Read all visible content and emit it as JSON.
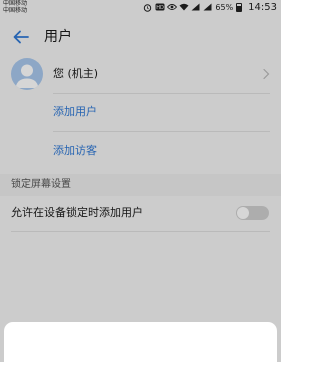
{
  "status_bar": {
    "carrier_line1": "中国移动",
    "carrier_line2": "中国移动",
    "network": "4G",
    "battery": "65%",
    "time": "14:53",
    "icons": [
      "alarm-icon",
      "hd-icon",
      "eye-icon",
      "wifi-icon",
      "signal-icon",
      "signal-icon",
      "battery-icon"
    ]
  },
  "header": {
    "title": "用户",
    "back_icon": "back-arrow-icon"
  },
  "users": {
    "owner_label": "您 (机主)",
    "add_user": "添加用户",
    "add_guest": "添加访客"
  },
  "lock_section": {
    "title": "锁定屏幕设置",
    "allow_add_users_label": "允许在设备锁定时添加用户",
    "allow_add_users_enabled": false
  },
  "colors": {
    "accent": "#2f78d4",
    "avatar_bg": "#a9c8ec"
  }
}
